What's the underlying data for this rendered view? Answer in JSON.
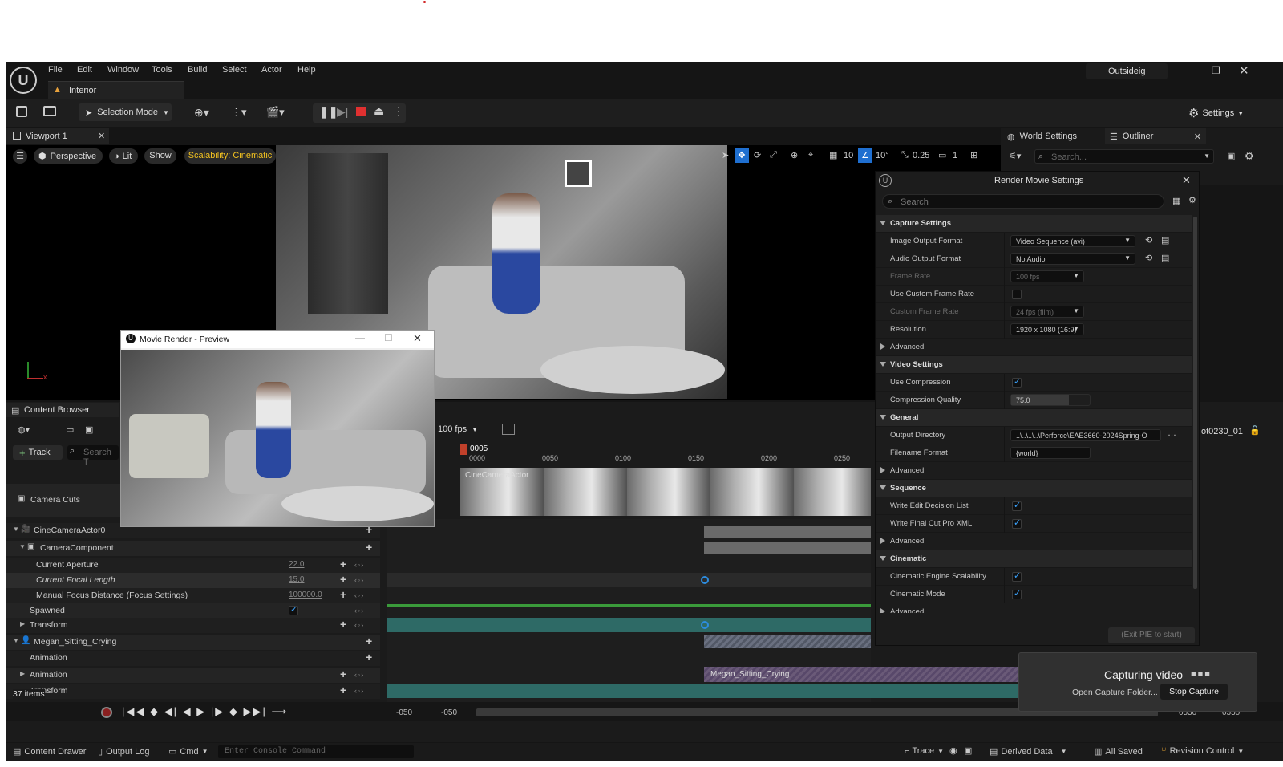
{
  "menu": [
    "File",
    "Edit",
    "Window",
    "Tools",
    "Build",
    "Select",
    "Actor",
    "Help"
  ],
  "project": "Interior",
  "user": "Outsideig",
  "toolbar": {
    "mode": "Selection Mode",
    "settings": "Settings"
  },
  "viewport": {
    "tab": "Viewport 1",
    "perspective": "Perspective",
    "lit": "Lit",
    "show": "Show",
    "scalability": "Scalability: Cinematic",
    "grid": "10",
    "angle": "10°",
    "scale": "0.25",
    "cams": "1"
  },
  "right_tabs": {
    "world": "World Settings",
    "outliner": "Outliner",
    "search": "Search..."
  },
  "render": {
    "title": "Render Movie Settings",
    "search": "Search",
    "exit_btn": "(Exit PIE to start)",
    "rows": [
      {
        "type": "cat",
        "label": "Capture Settings"
      },
      {
        "type": "dd",
        "label": "Image Output Format",
        "value": "Video Sequence (avi)",
        "icons": true
      },
      {
        "type": "dd",
        "label": "Audio Output Format",
        "value": "No Audio",
        "icons": true
      },
      {
        "type": "dd",
        "label": "Frame Rate",
        "value": "100 fps",
        "dim": true,
        "small": true
      },
      {
        "type": "cb",
        "label": "Use Custom Frame Rate",
        "checked": false
      },
      {
        "type": "dd",
        "label": "Custom Frame Rate",
        "value": "24 fps (film)",
        "dim": true,
        "small": true
      },
      {
        "type": "dd",
        "label": "Resolution",
        "value": "1920 x 1080 (16:9)",
        "small": true
      },
      {
        "type": "adv",
        "label": "Advanced"
      },
      {
        "type": "cat",
        "label": "Video Settings"
      },
      {
        "type": "cb",
        "label": "Use Compression",
        "checked": true
      },
      {
        "type": "num",
        "label": "Compression Quality",
        "value": "75.0"
      },
      {
        "type": "cat",
        "label": "General"
      },
      {
        "type": "path",
        "label": "Output Directory",
        "value": "..\\..\\..\\..\\Perforce\\EAE3660-2024Spring-O"
      },
      {
        "type": "txt",
        "label": "Filename Format",
        "value": "{world}"
      },
      {
        "type": "adv",
        "label": "Advanced"
      },
      {
        "type": "cat",
        "label": "Sequence"
      },
      {
        "type": "cb",
        "label": "Write Edit Decision List",
        "checked": true
      },
      {
        "type": "cb",
        "label": "Write Final Cut Pro XML",
        "checked": true
      },
      {
        "type": "adv",
        "label": "Advanced"
      },
      {
        "type": "cat",
        "label": "Cinematic"
      },
      {
        "type": "cb",
        "label": "Cinematic Engine Scalability",
        "checked": true
      },
      {
        "type": "cb",
        "label": "Cinematic Mode",
        "checked": true
      },
      {
        "type": "adv",
        "label": "Advanced"
      }
    ]
  },
  "preview": {
    "title": "Movie Render - Preview"
  },
  "content_browser": {
    "tab": "Content Browser",
    "track": "Track",
    "search": "Search T",
    "items": "37 items"
  },
  "sequencer": {
    "fps": "100 fps",
    "frame": "0005",
    "ticks": [
      "0000",
      "0050",
      "0100",
      "0150",
      "0200",
      "0250"
    ],
    "shot": "ot0230_01",
    "clip_label": "CineCameraActor",
    "anim_clip": "Megan_Sitting_Crying",
    "start_a": "-050",
    "start_b": "-050",
    "end_a": "0550",
    "end_b": "0550",
    "tree": [
      {
        "label": "Camera Cuts",
        "indent": 30,
        "icon": "cam"
      },
      {
        "label": "CineCameraActor0",
        "indent": 34,
        "icon": "actor",
        "tri": true
      },
      {
        "label": "CameraComponent",
        "indent": 42,
        "icon": "cam",
        "tri": true
      },
      {
        "label": "Current Aperture",
        "indent": 37,
        "value": "22.0"
      },
      {
        "label": "Current Focal Length",
        "indent": 37,
        "value": "15.0",
        "italic": true
      },
      {
        "label": "Manual Focus Distance (Focus Settings)",
        "indent": 37,
        "value": "100000.0"
      },
      {
        "label": "Spawned",
        "indent": 29,
        "check": true
      },
      {
        "label": "Transform",
        "indent": 29,
        "tri_r": true
      },
      {
        "label": "Megan_Sitting_Crying",
        "indent": 34,
        "icon": "person",
        "tri": true
      },
      {
        "label": "Animation",
        "indent": 29
      },
      {
        "label": "Animation",
        "indent": 29,
        "tri_r": true
      },
      {
        "label": "Transform",
        "indent": 29
      }
    ]
  },
  "capture": {
    "title": "Capturing video",
    "open": "Open Capture Folder...",
    "stop": "Stop Capture"
  },
  "status": {
    "drawer": "Content Drawer",
    "output": "Output Log",
    "cmd": "Cmd",
    "console": "Enter Console Command",
    "trace": "Trace",
    "derived": "Derived Data",
    "saved": "All Saved",
    "revision": "Revision Control"
  }
}
